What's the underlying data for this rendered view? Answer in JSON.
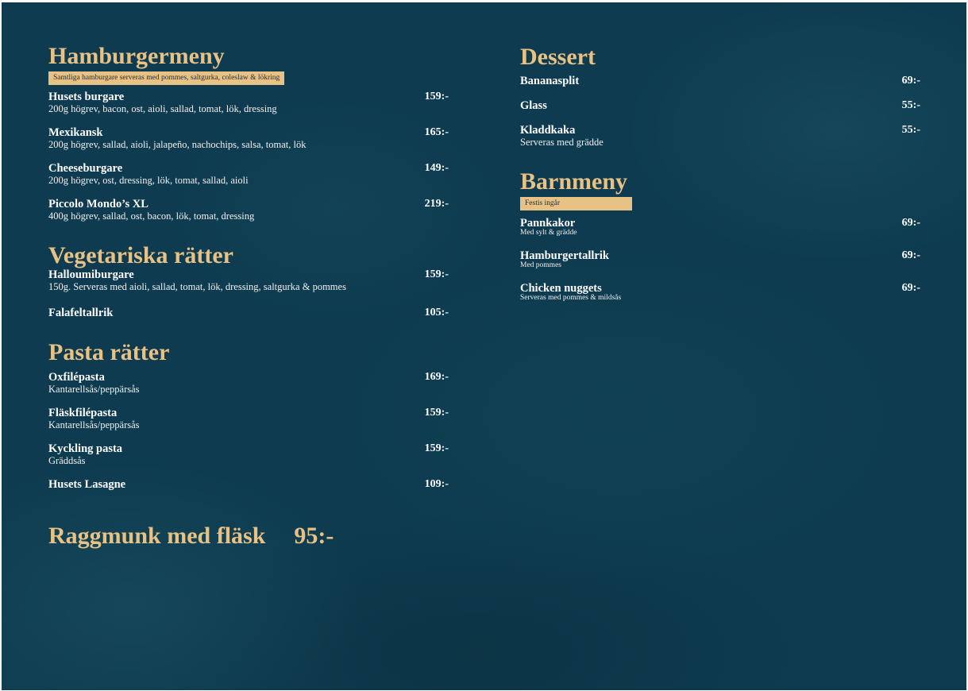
{
  "left": {
    "hamburger": {
      "title": "Hamburgermeny",
      "note": "Samtliga hamburgare serveras med pommes, saltgurka, coleslaw & lökring",
      "items": [
        {
          "name": "Husets burgare",
          "desc": "200g högrev, bacon, ost, aioli, sallad, tomat, lök, dressing",
          "price": "159:-"
        },
        {
          "name": "Mexikansk",
          "desc": "200g högrev, sallad, aioli, jalapeño, nachochips, salsa, tomat, lök",
          "price": "165:-"
        },
        {
          "name": "Cheeseburgare",
          "desc": "200g högrev, ost, dressing, lök, tomat, sallad, aioli",
          "price": "149:-"
        },
        {
          "name": "Piccolo Mondo’s XL",
          "desc": "400g högrev, sallad, ost, bacon, lök, tomat, dressing",
          "price": "219:-"
        }
      ]
    },
    "vegetarian": {
      "title": "Vegetariska rätter",
      "items": [
        {
          "name": "Halloumiburgare",
          "desc": "150g. Serveras med aioli, sallad, tomat, lök, dressing, saltgurka & pommes",
          "price": "159:-"
        },
        {
          "name": "Falafeltallrik",
          "price": "105:-"
        }
      ]
    },
    "pasta": {
      "title": "Pasta rätter",
      "items": [
        {
          "name": "Oxfilépasta",
          "desc": "Kantarellsås/peppärsås",
          "price": "169:-"
        },
        {
          "name": "Fläskfilépasta",
          "desc": "Kantarellsås/peppärsås",
          "price": "159:-"
        },
        {
          "name": "Kyckling pasta",
          "desc": "Gräddsås",
          "price": "159:-"
        },
        {
          "name": "Husets Lasagne",
          "price": "109:-"
        }
      ]
    },
    "special": {
      "name": "Raggmunk med fläsk",
      "price": "95:-"
    }
  },
  "right": {
    "dessert": {
      "title": "Dessert",
      "items": [
        {
          "name": "Bananasplit",
          "price": "69:-"
        },
        {
          "name": "Glass",
          "price": "55:-"
        },
        {
          "name": "Kladdkaka",
          "desc": "Serveras med grädde",
          "price": "55:-"
        }
      ]
    },
    "kids": {
      "title": "Barnmeny",
      "note": "Festis ingår",
      "items": [
        {
          "name": "Pannkakor",
          "desc": "Med sylt & grädde",
          "price": "69:-"
        },
        {
          "name": "Hamburgertallrik",
          "desc": "Med pommes",
          "price": "69:-"
        },
        {
          "name": "Chicken nuggets",
          "desc": "Serveras med pommes & mildsås",
          "price": "69:-"
        }
      ]
    }
  },
  "colors": {
    "background": "#0e3b4f",
    "accent": "#e8c184",
    "text": "#ffffff"
  }
}
